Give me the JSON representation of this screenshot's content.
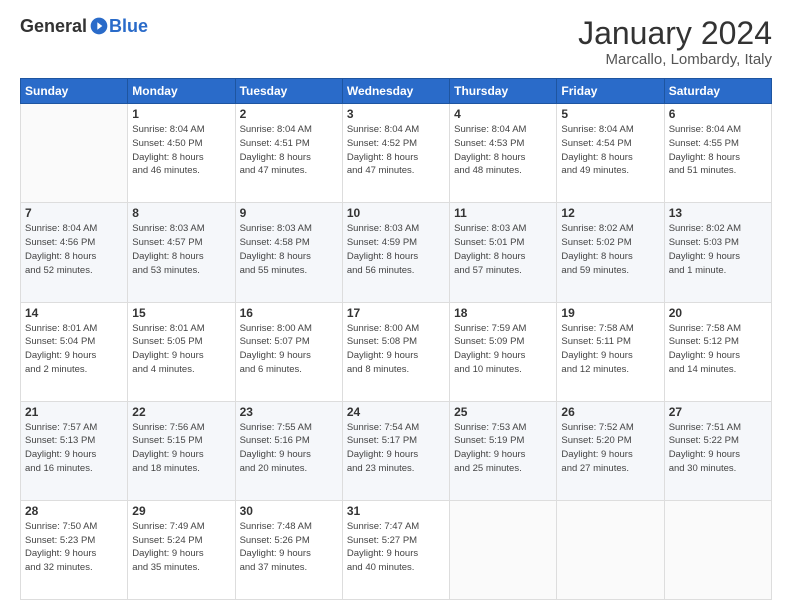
{
  "header": {
    "logo_general": "General",
    "logo_blue": "Blue",
    "month_title": "January 2024",
    "location": "Marcallo, Lombardy, Italy"
  },
  "calendar": {
    "days_of_week": [
      "Sunday",
      "Monday",
      "Tuesday",
      "Wednesday",
      "Thursday",
      "Friday",
      "Saturday"
    ],
    "weeks": [
      [
        {
          "day": "",
          "info": ""
        },
        {
          "day": "1",
          "info": "Sunrise: 8:04 AM\nSunset: 4:50 PM\nDaylight: 8 hours\nand 46 minutes."
        },
        {
          "day": "2",
          "info": "Sunrise: 8:04 AM\nSunset: 4:51 PM\nDaylight: 8 hours\nand 47 minutes."
        },
        {
          "day": "3",
          "info": "Sunrise: 8:04 AM\nSunset: 4:52 PM\nDaylight: 8 hours\nand 47 minutes."
        },
        {
          "day": "4",
          "info": "Sunrise: 8:04 AM\nSunset: 4:53 PM\nDaylight: 8 hours\nand 48 minutes."
        },
        {
          "day": "5",
          "info": "Sunrise: 8:04 AM\nSunset: 4:54 PM\nDaylight: 8 hours\nand 49 minutes."
        },
        {
          "day": "6",
          "info": "Sunrise: 8:04 AM\nSunset: 4:55 PM\nDaylight: 8 hours\nand 51 minutes."
        }
      ],
      [
        {
          "day": "7",
          "info": "Sunrise: 8:04 AM\nSunset: 4:56 PM\nDaylight: 8 hours\nand 52 minutes."
        },
        {
          "day": "8",
          "info": "Sunrise: 8:03 AM\nSunset: 4:57 PM\nDaylight: 8 hours\nand 53 minutes."
        },
        {
          "day": "9",
          "info": "Sunrise: 8:03 AM\nSunset: 4:58 PM\nDaylight: 8 hours\nand 55 minutes."
        },
        {
          "day": "10",
          "info": "Sunrise: 8:03 AM\nSunset: 4:59 PM\nDaylight: 8 hours\nand 56 minutes."
        },
        {
          "day": "11",
          "info": "Sunrise: 8:03 AM\nSunset: 5:01 PM\nDaylight: 8 hours\nand 57 minutes."
        },
        {
          "day": "12",
          "info": "Sunrise: 8:02 AM\nSunset: 5:02 PM\nDaylight: 8 hours\nand 59 minutes."
        },
        {
          "day": "13",
          "info": "Sunrise: 8:02 AM\nSunset: 5:03 PM\nDaylight: 9 hours\nand 1 minute."
        }
      ],
      [
        {
          "day": "14",
          "info": "Sunrise: 8:01 AM\nSunset: 5:04 PM\nDaylight: 9 hours\nand 2 minutes."
        },
        {
          "day": "15",
          "info": "Sunrise: 8:01 AM\nSunset: 5:05 PM\nDaylight: 9 hours\nand 4 minutes."
        },
        {
          "day": "16",
          "info": "Sunrise: 8:00 AM\nSunset: 5:07 PM\nDaylight: 9 hours\nand 6 minutes."
        },
        {
          "day": "17",
          "info": "Sunrise: 8:00 AM\nSunset: 5:08 PM\nDaylight: 9 hours\nand 8 minutes."
        },
        {
          "day": "18",
          "info": "Sunrise: 7:59 AM\nSunset: 5:09 PM\nDaylight: 9 hours\nand 10 minutes."
        },
        {
          "day": "19",
          "info": "Sunrise: 7:58 AM\nSunset: 5:11 PM\nDaylight: 9 hours\nand 12 minutes."
        },
        {
          "day": "20",
          "info": "Sunrise: 7:58 AM\nSunset: 5:12 PM\nDaylight: 9 hours\nand 14 minutes."
        }
      ],
      [
        {
          "day": "21",
          "info": "Sunrise: 7:57 AM\nSunset: 5:13 PM\nDaylight: 9 hours\nand 16 minutes."
        },
        {
          "day": "22",
          "info": "Sunrise: 7:56 AM\nSunset: 5:15 PM\nDaylight: 9 hours\nand 18 minutes."
        },
        {
          "day": "23",
          "info": "Sunrise: 7:55 AM\nSunset: 5:16 PM\nDaylight: 9 hours\nand 20 minutes."
        },
        {
          "day": "24",
          "info": "Sunrise: 7:54 AM\nSunset: 5:17 PM\nDaylight: 9 hours\nand 23 minutes."
        },
        {
          "day": "25",
          "info": "Sunrise: 7:53 AM\nSunset: 5:19 PM\nDaylight: 9 hours\nand 25 minutes."
        },
        {
          "day": "26",
          "info": "Sunrise: 7:52 AM\nSunset: 5:20 PM\nDaylight: 9 hours\nand 27 minutes."
        },
        {
          "day": "27",
          "info": "Sunrise: 7:51 AM\nSunset: 5:22 PM\nDaylight: 9 hours\nand 30 minutes."
        }
      ],
      [
        {
          "day": "28",
          "info": "Sunrise: 7:50 AM\nSunset: 5:23 PM\nDaylight: 9 hours\nand 32 minutes."
        },
        {
          "day": "29",
          "info": "Sunrise: 7:49 AM\nSunset: 5:24 PM\nDaylight: 9 hours\nand 35 minutes."
        },
        {
          "day": "30",
          "info": "Sunrise: 7:48 AM\nSunset: 5:26 PM\nDaylight: 9 hours\nand 37 minutes."
        },
        {
          "day": "31",
          "info": "Sunrise: 7:47 AM\nSunset: 5:27 PM\nDaylight: 9 hours\nand 40 minutes."
        },
        {
          "day": "",
          "info": ""
        },
        {
          "day": "",
          "info": ""
        },
        {
          "day": "",
          "info": ""
        }
      ]
    ]
  }
}
